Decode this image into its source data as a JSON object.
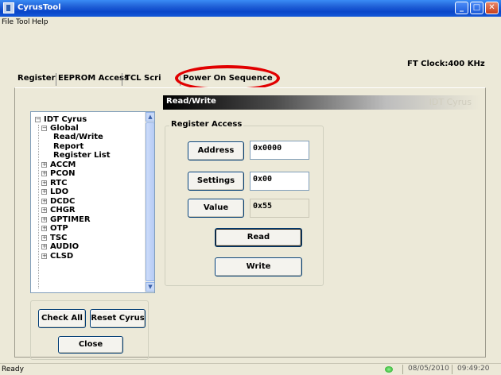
{
  "window": {
    "title": "CyrusTool"
  },
  "menu": [
    "File",
    "Tool",
    "Help"
  ],
  "clock": "FT Clock:400 KHz",
  "tabs": [
    "Register",
    "EEPROM Access",
    "TCL Script",
    "Power On Sequence"
  ],
  "tab_visible_labels": [
    "Register",
    "EEPROM Access",
    "TCL Scri",
    "Power On Sequence"
  ],
  "header": {
    "title": "Read/Write",
    "right": "IDT Cyrus"
  },
  "tree": {
    "root": "IDT Cyrus",
    "global": "Global",
    "global_children": [
      "Read/Write",
      "Report",
      "Register List"
    ],
    "groups": [
      "ACCM",
      "PCON",
      "RTC",
      "LDO",
      "DCDC",
      "CHGR",
      "GPTIMER",
      "OTP",
      "TSC",
      "AUDIO",
      "CLSD"
    ]
  },
  "register_access": {
    "label": "Register Access",
    "address_label": "Address",
    "address_value": "0x0000",
    "settings_label": "Settings",
    "settings_value": "0x00",
    "value_label": "Value",
    "value_value": "0x55",
    "read_label": "Read",
    "write_label": "Write"
  },
  "buttons": {
    "check_all": "Check All",
    "reset": "Reset Cyrus",
    "close": "Close"
  },
  "status": {
    "text": "Ready",
    "date": "08/05/2010",
    "time": "09:49:20"
  }
}
